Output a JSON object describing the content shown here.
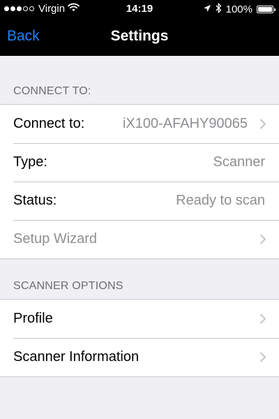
{
  "status_bar": {
    "carrier": "Virgin",
    "time": "14:19",
    "battery": "100%",
    "battery_level": 1.0,
    "signal_bars_filled": 3,
    "signal_bars_total": 5,
    "icons": [
      "signal-dots-icon",
      "wifi-icon",
      "location-arrow-icon",
      "bluetooth-icon",
      "battery-icon"
    ]
  },
  "nav": {
    "back_label": "Back",
    "title": "Settings"
  },
  "connect_section": {
    "header": "CONNECT TO:",
    "rows": [
      {
        "label": "Connect to:",
        "value": "iX100-AFAHY90065",
        "chevron": true
      },
      {
        "label": "Type:",
        "value": "Scanner",
        "chevron": false
      },
      {
        "label": "Status:",
        "value": "Ready to scan",
        "chevron": false
      },
      {
        "label": "Setup Wizard",
        "chevron": true,
        "disabled": true
      }
    ]
  },
  "scanner_section": {
    "header": "SCANNER OPTIONS",
    "rows": [
      {
        "label": "Profile",
        "chevron": true
      },
      {
        "label": "Scanner Information",
        "chevron": true
      }
    ]
  },
  "colors": {
    "accent": "#1a82fb",
    "background": "#efeff4",
    "navbar": "#000000",
    "secondary_text": "#8e8e93",
    "separator": "#c8c7cc"
  }
}
